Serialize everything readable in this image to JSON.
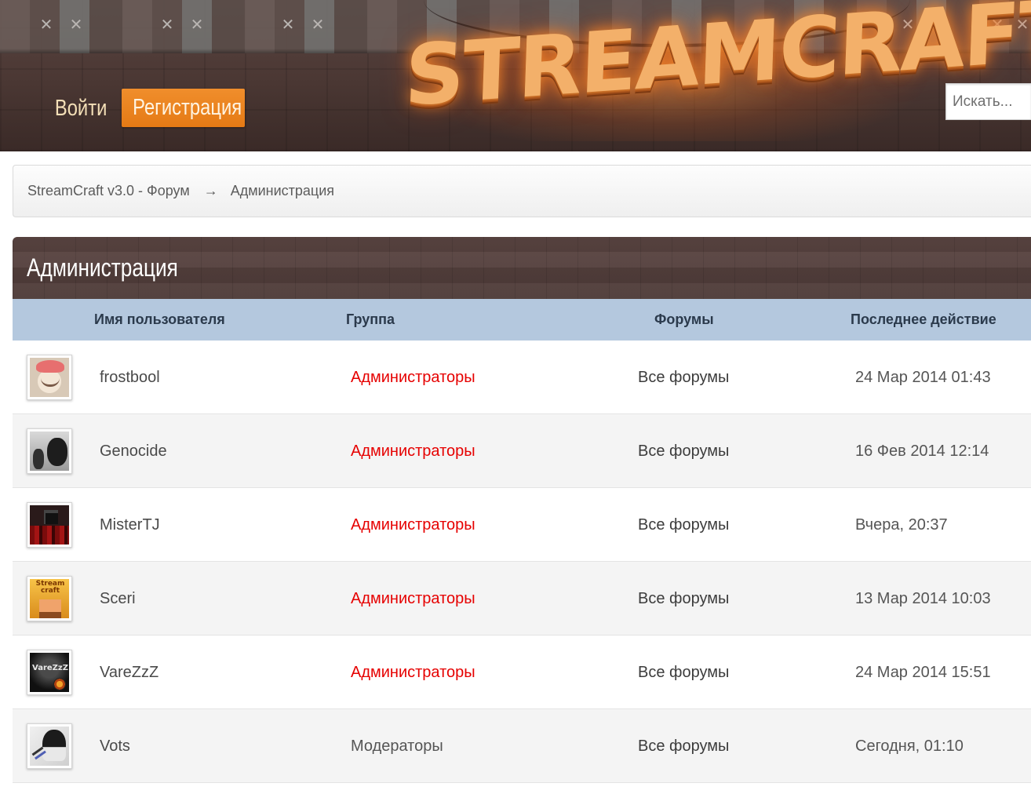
{
  "header": {
    "logo_text": "STREAMCRAFT",
    "login_label": "Войти",
    "register_label": "Регистрация",
    "search_placeholder": "Искать..."
  },
  "breadcrumb": {
    "root": "StreamCraft v3.0 - Форум",
    "separator": "→",
    "current": "Администрация"
  },
  "panel": {
    "title": "Администрация"
  },
  "table": {
    "columns": {
      "username": "Имя пользователя",
      "group": "Группа",
      "forums": "Форумы",
      "last_action": "Последнее действие"
    },
    "rows": [
      {
        "username": "frostbool",
        "group": "Администраторы",
        "forums": "Все форумы",
        "last_action": "24 Мар 2014 01:43"
      },
      {
        "username": "Genocide",
        "group": "Администраторы",
        "forums": "Все форумы",
        "last_action": "16 Фев 2014 12:14"
      },
      {
        "username": "MisterTJ",
        "group": "Администраторы",
        "forums": "Все форумы",
        "last_action": "Вчера, 20:37"
      },
      {
        "username": "Sceri",
        "group": "Администраторы",
        "forums": "Все форумы",
        "last_action": "13 Мар 2014 10:03"
      },
      {
        "username": "VareZzZ",
        "group": "Администраторы",
        "forums": "Все форумы",
        "last_action": "24 Мар 2014 15:51"
      },
      {
        "username": "Vots",
        "group": "Модераторы",
        "forums": "Все форумы",
        "last_action": "Сегодня, 01:10"
      }
    ]
  },
  "colors": {
    "accent_orange": "#e57a15",
    "admin_red": "#e60000",
    "table_header_blue": "#b4c8de",
    "header_brown": "#4a3733"
  }
}
